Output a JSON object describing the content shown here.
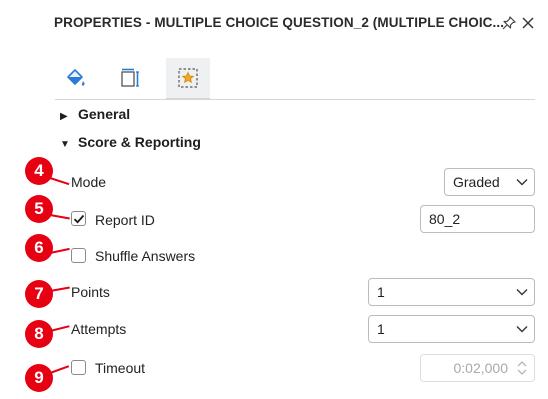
{
  "panel": {
    "title": "PROPERTIES - MULTIPLE CHOICE QUESTION_2 (MULTIPLE CHOIC...",
    "pin_icon": "pin-icon",
    "close_icon": "close-icon"
  },
  "tabs": [
    {
      "name": "fill-style-tab",
      "icon": "paint-bucket-icon",
      "active": false
    },
    {
      "name": "size-position-tab",
      "icon": "resize-icon",
      "active": false
    },
    {
      "name": "interaction-tab",
      "icon": "star-frame-icon",
      "active": true
    }
  ],
  "sections": {
    "general": {
      "label": "General",
      "expanded": false
    },
    "score_reporting": {
      "label": "Score & Reporting",
      "expanded": true
    }
  },
  "fields": {
    "mode": {
      "label": "Mode",
      "value": "Graded"
    },
    "report_id": {
      "label": "Report ID",
      "checked": true,
      "value": "80_2"
    },
    "shuffle": {
      "label": "Shuffle Answers",
      "checked": false
    },
    "points": {
      "label": "Points",
      "value": "1"
    },
    "attempts": {
      "label": "Attempts",
      "value": "1"
    },
    "timeout": {
      "label": "Timeout",
      "checked": false,
      "value": "0:02,000",
      "disabled": true
    }
  },
  "markers": [
    "4",
    "5",
    "6",
    "7",
    "8",
    "9"
  ],
  "colors": {
    "marker": "#e60012",
    "accent": "#2b7bd6"
  }
}
